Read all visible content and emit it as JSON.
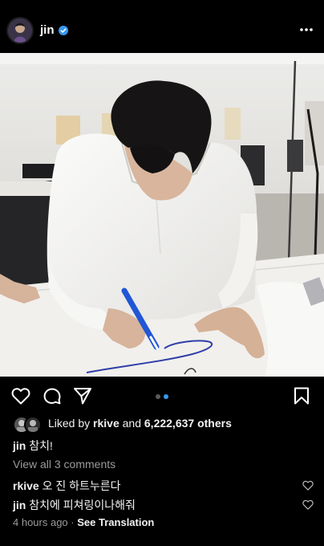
{
  "post": {
    "username": "jin",
    "caption": "참치!",
    "likes_prefix": "Liked by",
    "liked_by": "rkive",
    "likes_joiner": "and",
    "likes_count": "6,222,637 others",
    "view_comments": "View all 3 comments",
    "timestamp": "4 hours ago",
    "separator": "·",
    "see_translation": "See Translation",
    "carousel": {
      "count": 2,
      "active_index": 1
    }
  },
  "comments": [
    {
      "user": "rkive",
      "text": "오 진 하트누른다"
    },
    {
      "user": "jin",
      "text": "참치에 피쳐링이나해줘"
    }
  ],
  "colors": {
    "background": "#000000",
    "text": "#f5f5f5",
    "muted": "#9a9a9a",
    "verified": "#3897f0",
    "carousel_active": "#3897f0"
  },
  "icons": [
    "verified-badge-icon",
    "more-options-icon",
    "heart-icon",
    "comment-icon",
    "share-icon",
    "bookmark-icon"
  ]
}
